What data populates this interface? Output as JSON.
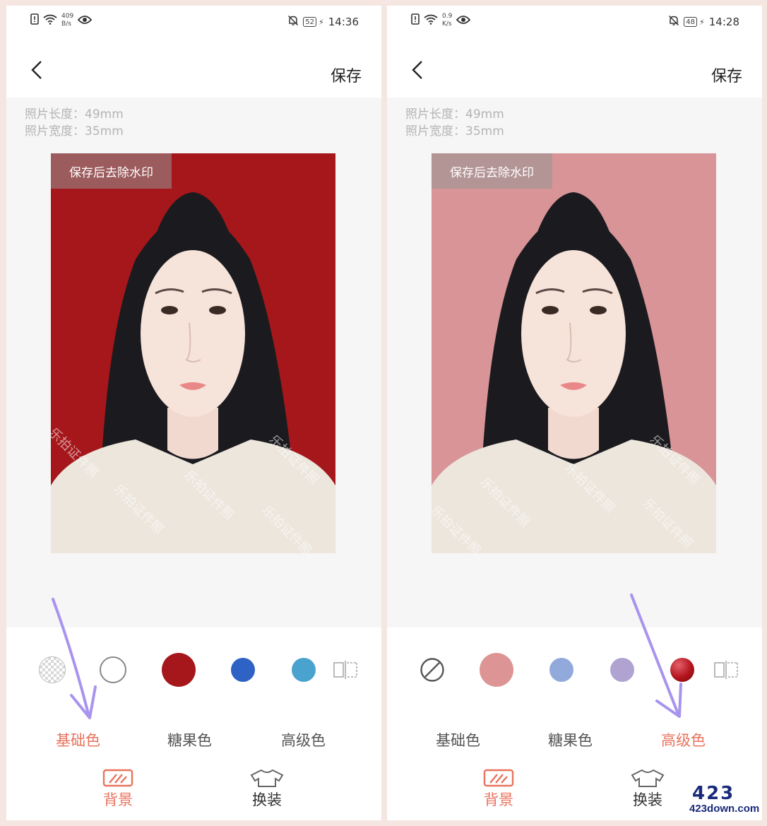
{
  "screens": [
    {
      "status": {
        "speed_value": "409",
        "speed_unit": "B/s",
        "battery": "52",
        "time": "14:36"
      },
      "nav": {
        "save_label": "保存"
      },
      "photo_info": {
        "length": "照片长度：49mm",
        "width": "照片宽度：35mm"
      },
      "photo": {
        "background": "#a5171b",
        "watermark_badge": "保存后去除水印",
        "watermark_text": "乐拍证件照"
      },
      "swatches": [
        {
          "name": "transparent",
          "color": "#e0e0e0"
        },
        {
          "name": "white",
          "color": "#ffffff"
        },
        {
          "name": "red",
          "color": "#a5171b",
          "selected": true
        },
        {
          "name": "blue",
          "color": "#2e62c4"
        },
        {
          "name": "light-blue",
          "color": "#4aa3cf"
        }
      ],
      "categories": [
        {
          "label": "基础色",
          "active": true
        },
        {
          "label": "糖果色",
          "active": false
        },
        {
          "label": "高级色",
          "active": false
        }
      ],
      "bottom_tabs": [
        {
          "label": "背景",
          "active": true
        },
        {
          "label": "换装",
          "active": false
        }
      ]
    },
    {
      "status": {
        "speed_value": "0.9",
        "speed_unit": "K/s",
        "battery": "48",
        "time": "14:28"
      },
      "nav": {
        "save_label": "保存"
      },
      "photo_info": {
        "length": "照片长度：49mm",
        "width": "照片宽度：35mm"
      },
      "photo": {
        "background": "#d99497",
        "watermark_badge": "保存后去除水印",
        "watermark_text": "乐拍证件照"
      },
      "swatches": [
        {
          "name": "none",
          "color": "#ffffff"
        },
        {
          "name": "pink",
          "color": "#dd9494",
          "selected": true
        },
        {
          "name": "periwinkle",
          "color": "#92a9dc"
        },
        {
          "name": "lavender",
          "color": "#b0a3d2"
        },
        {
          "name": "crimson-gradient",
          "color": "#b3141d"
        }
      ],
      "categories": [
        {
          "label": "基础色",
          "active": false
        },
        {
          "label": "糖果色",
          "active": false
        },
        {
          "label": "高级色",
          "active": true
        }
      ],
      "bottom_tabs": [
        {
          "label": "背景",
          "active": true
        },
        {
          "label": "换装",
          "active": false
        }
      ]
    }
  ],
  "site_logo": {
    "number": "423",
    "url": "423down.com"
  },
  "accent_color": "#e8735e",
  "arrow_color": "#a894ee"
}
